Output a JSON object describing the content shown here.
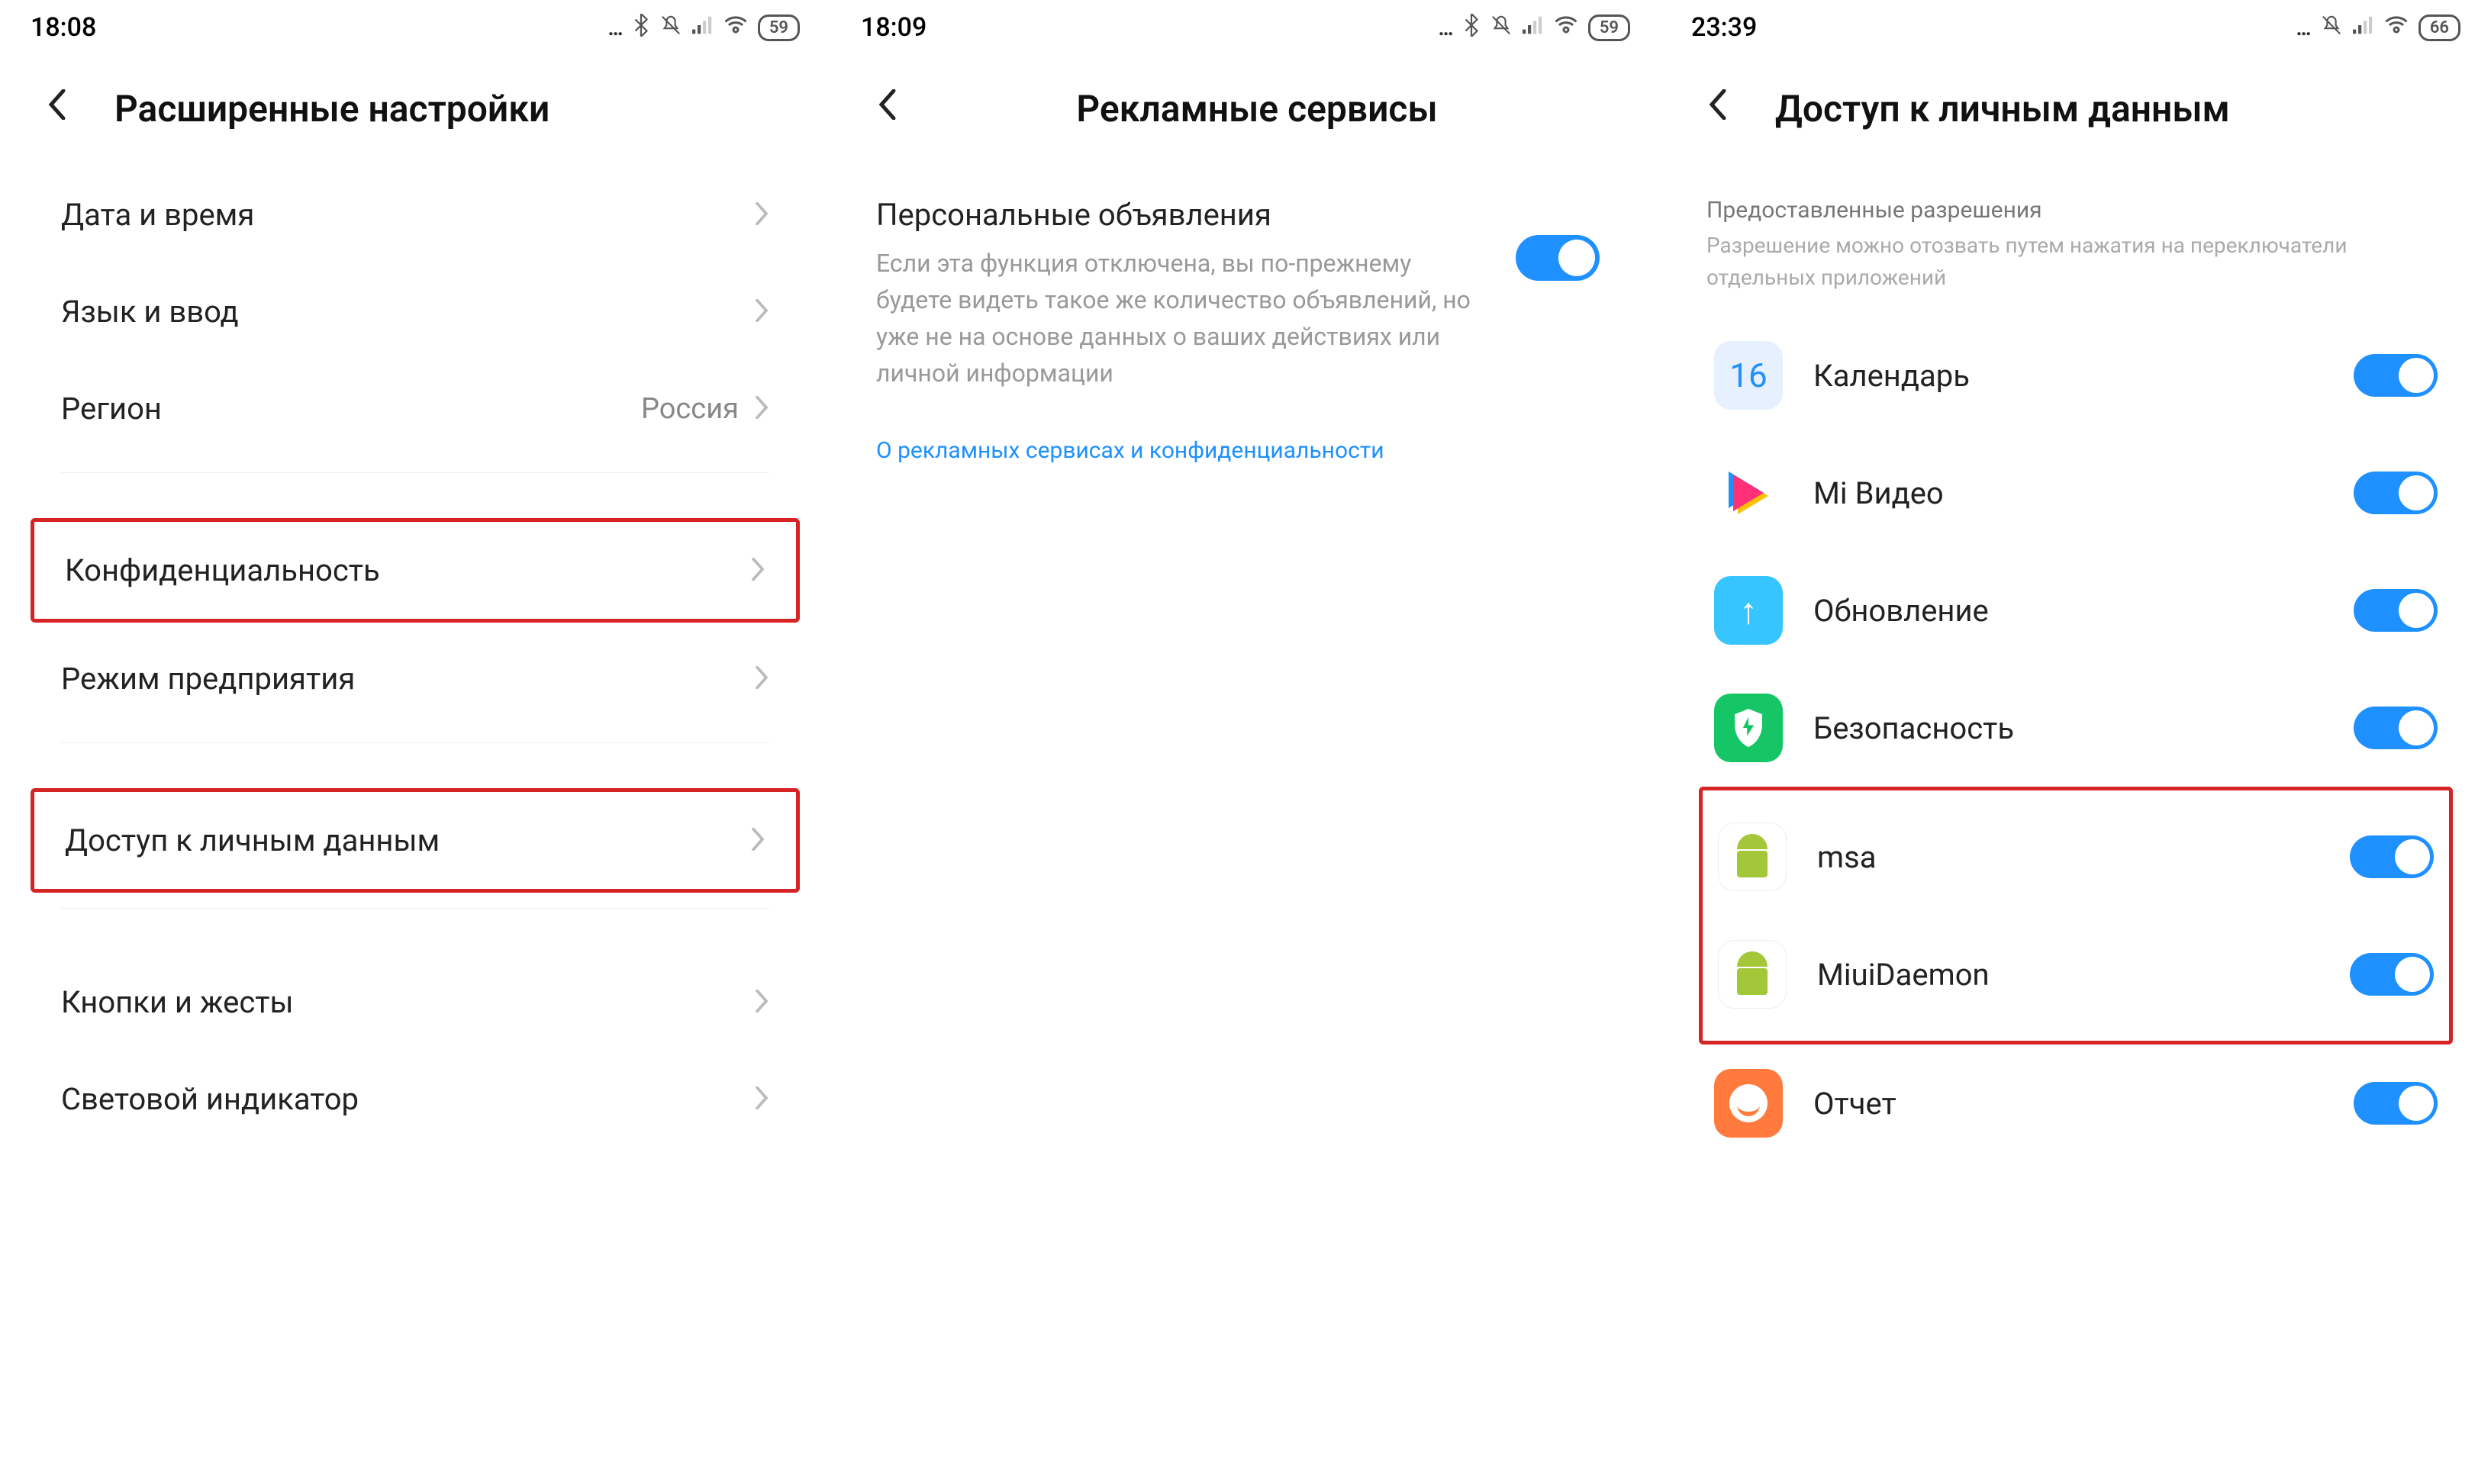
{
  "panel1": {
    "time": "18:08",
    "battery": "59",
    "title": "Расширенные настройки",
    "items": [
      {
        "label": "Дата и время",
        "value": ""
      },
      {
        "label": "Язык и ввод",
        "value": ""
      },
      {
        "label": "Регион",
        "value": "Россия"
      },
      {
        "label": "Конфиденциальность",
        "value": "",
        "hl": true
      },
      {
        "label": "Режим предприятия",
        "value": ""
      },
      {
        "label": "Доступ к личным данным",
        "value": "",
        "hl": true
      },
      {
        "label": "Кнопки и жесты",
        "value": ""
      },
      {
        "label": "Световой индикатор",
        "value": ""
      }
    ]
  },
  "panel2": {
    "time": "18:09",
    "battery": "59",
    "title": "Рекламные сервисы",
    "setting_title": "Персональные объявления",
    "setting_desc": "Если эта функция отключена, вы по-прежнему будете видеть такое же количество объявлений, но уже не на основе данных о ваших действиях или личной информации",
    "link": "О рекламных сервисах и конфиденциальности"
  },
  "panel3": {
    "time": "23:39",
    "battery": "66",
    "title": "Доступ к личным данным",
    "section_title": "Предоставленные разрешения",
    "section_sub": "Разрешение можно отозвать путем нажатия на переключатели отдельных приложений",
    "apps": [
      {
        "label": "Календарь",
        "icon": "calendar"
      },
      {
        "label": "Mi Видео",
        "icon": "video"
      },
      {
        "label": "Обновление",
        "icon": "update"
      },
      {
        "label": "Безопасность",
        "icon": "security"
      },
      {
        "label": "msa",
        "icon": "android",
        "hl": true
      },
      {
        "label": "MiuiDaemon",
        "icon": "android",
        "hl": true
      },
      {
        "label": "Отчет",
        "icon": "report"
      }
    ]
  }
}
